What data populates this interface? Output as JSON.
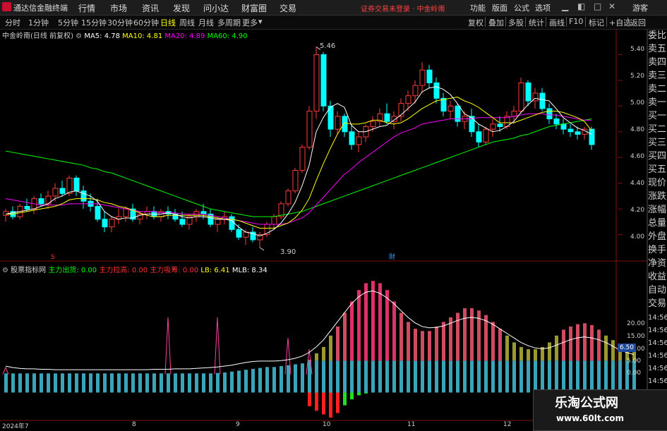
{
  "app": {
    "title": "通达信金融终端",
    "warning": "证券交易未登录 · 中金岭南"
  },
  "menus": [
    "行情",
    "市场",
    "资讯",
    "发现",
    "问小达",
    "财富圈",
    "交易"
  ],
  "right_menus": [
    "功能",
    "版面",
    "公式",
    "选项"
  ],
  "window_controls": {
    "guest": "游客"
  },
  "periods": [
    "分时",
    "1分钟",
    "5分钟",
    "15分钟",
    "30分钟",
    "60分钟",
    "日线",
    "周线",
    "月线",
    "多周期",
    "更多"
  ],
  "active_period": "日线",
  "tools": [
    "复权",
    "叠加",
    "多股",
    "统计",
    "画线",
    "F10",
    "标记",
    "+自选",
    "返回"
  ],
  "main_legend": {
    "stock": "中金岭南(日线 前复权)",
    "ma5": "MA5: 4.78",
    "ma10": "MA10: 4.81",
    "ma20": "MA20: 4.89",
    "ma60": "MA60: 4.90"
  },
  "indicator_legend": {
    "name": "股票指标网",
    "out": "主力出货: 0.00",
    "pull": "主力拉高: 0.00",
    "hold": "主力吸筹: 0.00",
    "lb": "LB: 6.41",
    "mlb": "MLB: 8.34"
  },
  "price_axis": [
    "5.40",
    "5.20",
    "5.00",
    "4.80",
    "4.60",
    "4.40",
    "4.20",
    "4.00"
  ],
  "indicator_axis": [
    "20.00",
    "15.00",
    "10.00",
    "5.00",
    "0.00"
  ],
  "indicator_tag": "6.50",
  "annotations": {
    "high": "5.46",
    "low": "3.90",
    "s_marker": "S",
    "cai_marker": "财"
  },
  "date_axis": [
    "2024年7",
    "8",
    "9",
    "10",
    "11",
    "12"
  ],
  "side_panel": [
    "委比",
    "卖五",
    "卖四",
    "卖三",
    "卖二",
    "卖一",
    "买一",
    "买二",
    "买三",
    "买四",
    "买五",
    "现价",
    "涨跌",
    "涨幅",
    "总量",
    "外盘",
    "换手",
    "净资",
    "收益",
    "自动",
    "交易"
  ],
  "side_times": [
    "14:56",
    "14:56",
    "14:56",
    "14:56",
    "14:56",
    "14:56",
    "14:56",
    "14:56"
  ],
  "watermark": {
    "line1": "乐淘公式网",
    "line2": "www.60lt.com"
  },
  "colors": {
    "up": "#ff3a3a",
    "down": "#00ffff",
    "ma5": "#ffffff",
    "ma10": "#ffff00",
    "ma20": "#ff00ff",
    "ma60": "#00ff00"
  },
  "chart_data": [
    {
      "type": "candlestick",
      "title": "中金岭南(日线 前复权)",
      "ylim": [
        3.85,
        5.55
      ],
      "annotations": {
        "high": 5.46,
        "low": 3.9
      },
      "candles": [
        [
          4.15,
          4.2,
          4.1,
          4.18
        ],
        [
          4.18,
          4.22,
          4.12,
          4.14
        ],
        [
          4.14,
          4.24,
          4.12,
          4.22
        ],
        [
          4.22,
          4.28,
          4.18,
          4.2
        ],
        [
          4.2,
          4.3,
          4.16,
          4.28
        ],
        [
          4.28,
          4.32,
          4.22,
          4.24
        ],
        [
          4.24,
          4.34,
          4.2,
          4.3
        ],
        [
          4.3,
          4.4,
          4.26,
          4.36
        ],
        [
          4.36,
          4.42,
          4.3,
          4.32
        ],
        [
          4.32,
          4.46,
          4.3,
          4.44
        ],
        [
          4.44,
          4.46,
          4.3,
          4.34
        ],
        [
          4.34,
          4.38,
          4.2,
          4.26
        ],
        [
          4.26,
          4.32,
          4.18,
          4.22
        ],
        [
          4.22,
          4.28,
          4.1,
          4.12
        ],
        [
          4.12,
          4.18,
          4.02,
          4.06
        ],
        [
          4.06,
          4.14,
          4.02,
          4.12
        ],
        [
          4.12,
          4.2,
          4.08,
          4.14
        ],
        [
          4.14,
          4.22,
          4.1,
          4.2
        ],
        [
          4.2,
          4.24,
          4.1,
          4.12
        ],
        [
          4.12,
          4.18,
          4.08,
          4.16
        ],
        [
          4.16,
          4.22,
          4.12,
          4.18
        ],
        [
          4.18,
          4.22,
          4.12,
          4.14
        ],
        [
          4.14,
          4.2,
          4.1,
          4.18
        ],
        [
          4.18,
          4.22,
          4.12,
          4.16
        ],
        [
          4.16,
          4.2,
          4.1,
          4.12
        ],
        [
          4.12,
          4.18,
          4.06,
          4.08
        ],
        [
          4.08,
          4.16,
          4.04,
          4.14
        ],
        [
          4.14,
          4.2,
          4.1,
          4.18
        ],
        [
          4.18,
          4.24,
          4.12,
          4.16
        ],
        [
          4.16,
          4.2,
          4.06,
          4.08
        ],
        [
          4.08,
          4.14,
          4.02,
          4.12
        ],
        [
          4.12,
          4.18,
          4.08,
          4.14
        ],
        [
          4.14,
          4.16,
          4.02,
          4.04
        ],
        [
          4.04,
          4.08,
          3.96,
          3.98
        ],
        [
          3.98,
          4.04,
          3.92,
          4.02
        ],
        [
          4.02,
          4.06,
          3.94,
          3.96
        ],
        [
          3.96,
          4.02,
          3.9,
          4.0
        ],
        [
          4.0,
          4.1,
          3.98,
          4.08
        ],
        [
          4.08,
          4.16,
          4.04,
          4.14
        ],
        [
          4.14,
          4.26,
          4.12,
          4.24
        ],
        [
          4.24,
          4.36,
          4.22,
          4.34
        ],
        [
          4.34,
          4.52,
          4.32,
          4.5
        ],
        [
          4.5,
          4.7,
          4.48,
          4.68
        ],
        [
          4.68,
          5.0,
          4.66,
          4.96
        ],
        [
          4.96,
          5.46,
          4.9,
          5.4
        ],
        [
          5.4,
          5.42,
          4.96,
          5.0
        ],
        [
          5.0,
          5.04,
          4.76,
          4.82
        ],
        [
          4.82,
          4.96,
          4.78,
          4.92
        ],
        [
          4.92,
          4.94,
          4.76,
          4.8
        ],
        [
          4.8,
          4.86,
          4.66,
          4.7
        ],
        [
          4.7,
          4.8,
          4.64,
          4.76
        ],
        [
          4.76,
          4.86,
          4.72,
          4.84
        ],
        [
          4.84,
          4.92,
          4.8,
          4.88
        ],
        [
          4.88,
          4.98,
          4.84,
          4.94
        ],
        [
          4.94,
          5.02,
          4.86,
          4.88
        ],
        [
          4.88,
          4.96,
          4.82,
          4.92
        ],
        [
          4.92,
          5.06,
          4.88,
          5.02
        ],
        [
          5.02,
          5.12,
          4.96,
          5.08
        ],
        [
          5.08,
          5.2,
          5.02,
          5.16
        ],
        [
          5.16,
          5.34,
          5.1,
          5.28
        ],
        [
          5.28,
          5.32,
          5.14,
          5.18
        ],
        [
          5.18,
          5.22,
          5.02,
          5.06
        ],
        [
          5.06,
          5.1,
          4.92,
          4.96
        ],
        [
          4.96,
          5.04,
          4.9,
          5.0
        ],
        [
          5.0,
          5.02,
          4.84,
          4.88
        ],
        [
          4.88,
          4.96,
          4.82,
          4.92
        ],
        [
          4.92,
          4.98,
          4.76,
          4.8
        ],
        [
          4.8,
          4.86,
          4.68,
          4.72
        ],
        [
          4.72,
          4.84,
          4.7,
          4.82
        ],
        [
          4.82,
          4.9,
          4.76,
          4.86
        ],
        [
          4.86,
          4.92,
          4.8,
          4.84
        ],
        [
          4.84,
          4.96,
          4.82,
          4.92
        ],
        [
          4.92,
          5.0,
          4.86,
          4.96
        ],
        [
          4.96,
          5.22,
          4.94,
          5.18
        ],
        [
          5.18,
          5.2,
          5.0,
          5.04
        ],
        [
          5.04,
          5.14,
          4.98,
          5.1
        ],
        [
          5.1,
          5.14,
          4.96,
          4.98
        ],
        [
          4.98,
          5.02,
          4.86,
          4.9
        ],
        [
          4.9,
          4.94,
          4.82,
          4.86
        ],
        [
          4.86,
          4.9,
          4.78,
          4.82
        ],
        [
          4.82,
          4.86,
          4.76,
          4.8
        ],
        [
          4.8,
          4.84,
          4.74,
          4.78
        ],
        [
          4.78,
          4.84,
          4.74,
          4.82
        ],
        [
          4.82,
          4.84,
          4.66,
          4.7
        ]
      ],
      "ma5": [
        4.16,
        4.17,
        4.18,
        4.19,
        4.2,
        4.22,
        4.24,
        4.28,
        4.3,
        4.33,
        4.34,
        4.32,
        4.3,
        4.26,
        4.18,
        4.14,
        4.12,
        4.13,
        4.13,
        4.15,
        4.16,
        4.16,
        4.16,
        4.17,
        4.16,
        4.14,
        4.13,
        4.14,
        4.14,
        4.13,
        4.12,
        4.12,
        4.11,
        4.06,
        4.02,
        4.01,
        3.99,
        4.01,
        4.04,
        4.09,
        4.16,
        4.25,
        4.38,
        4.54,
        4.8,
        4.91,
        4.99,
        5.02,
        4.99,
        4.85,
        4.8,
        4.8,
        4.82,
        4.84,
        4.85,
        4.89,
        4.93,
        4.98,
        5.03,
        5.11,
        5.14,
        5.15,
        5.13,
        5.09,
        5.02,
        4.94,
        4.91,
        4.86,
        4.83,
        4.8,
        4.81,
        4.84,
        4.88,
        4.95,
        5.01,
        5.06,
        5.05,
        5.04,
        4.98,
        4.91,
        4.87,
        4.83,
        4.81,
        4.78
      ],
      "ma10": [
        4.16,
        4.16,
        4.17,
        4.18,
        4.19,
        4.2,
        4.21,
        4.22,
        4.24,
        4.27,
        4.28,
        4.28,
        4.28,
        4.27,
        4.25,
        4.24,
        4.22,
        4.21,
        4.19,
        4.17,
        4.15,
        4.14,
        4.14,
        4.15,
        4.15,
        4.15,
        4.15,
        4.15,
        4.15,
        4.14,
        4.13,
        4.12,
        4.12,
        4.11,
        4.09,
        4.07,
        4.05,
        4.05,
        4.05,
        4.07,
        4.09,
        4.13,
        4.19,
        4.28,
        4.42,
        4.55,
        4.67,
        4.78,
        4.87,
        4.86,
        4.86,
        4.87,
        4.89,
        4.89,
        4.87,
        4.86,
        4.87,
        4.9,
        4.94,
        4.98,
        5.01,
        5.04,
        5.05,
        5.06,
        5.07,
        5.04,
        5.02,
        4.99,
        4.95,
        4.91,
        4.87,
        4.87,
        4.87,
        4.89,
        4.91,
        4.93,
        4.95,
        4.96,
        4.96,
        4.95,
        4.93,
        4.91,
        4.88,
        4.81
      ],
      "ma20": [
        4.28,
        4.27,
        4.26,
        4.25,
        4.24,
        4.23,
        4.23,
        4.23,
        4.23,
        4.24,
        4.24,
        4.24,
        4.24,
        4.24,
        4.23,
        4.22,
        4.21,
        4.2,
        4.19,
        4.18,
        4.18,
        4.18,
        4.17,
        4.17,
        4.17,
        4.16,
        4.16,
        4.16,
        4.16,
        4.15,
        4.14,
        4.13,
        4.12,
        4.11,
        4.1,
        4.09,
        4.08,
        4.08,
        4.08,
        4.08,
        4.09,
        4.11,
        4.13,
        4.17,
        4.23,
        4.29,
        4.35,
        4.41,
        4.47,
        4.51,
        4.56,
        4.6,
        4.64,
        4.68,
        4.72,
        4.76,
        4.79,
        4.81,
        4.83,
        4.86,
        4.87,
        4.88,
        4.89,
        4.9,
        4.9,
        4.9,
        4.9,
        4.91,
        4.91,
        4.91,
        4.91,
        4.91,
        4.92,
        4.93,
        4.94,
        4.94,
        4.94,
        4.93,
        4.93,
        4.92,
        4.91,
        4.9,
        4.89,
        4.89
      ],
      "ma60": [
        4.65,
        4.64,
        4.63,
        4.62,
        4.61,
        4.6,
        4.59,
        4.58,
        4.57,
        4.56,
        4.55,
        4.54,
        4.52,
        4.51,
        4.49,
        4.48,
        4.46,
        4.44,
        4.42,
        4.4,
        4.38,
        4.36,
        4.34,
        4.32,
        4.3,
        4.28,
        4.26,
        4.24,
        4.22,
        4.2,
        4.19,
        4.18,
        4.17,
        4.16,
        4.15,
        4.14,
        4.14,
        4.14,
        4.14,
        4.15,
        4.16,
        4.17,
        4.18,
        4.2,
        4.22,
        4.24,
        4.26,
        4.28,
        4.3,
        4.32,
        4.34,
        4.36,
        4.38,
        4.4,
        4.42,
        4.44,
        4.46,
        4.48,
        4.5,
        4.52,
        4.54,
        4.56,
        4.58,
        4.6,
        4.62,
        4.64,
        4.66,
        4.68,
        4.7,
        4.72,
        4.73,
        4.74,
        4.75,
        4.77,
        4.78,
        4.8,
        4.82,
        4.84,
        4.85,
        4.86,
        4.87,
        4.88,
        4.89,
        4.9
      ]
    },
    {
      "type": "bar",
      "title": "股票指标网",
      "ylim": [
        -5.5,
        25
      ],
      "lb_bars": [
        4.2,
        4.2,
        4.2,
        4.2,
        4.2,
        4.2,
        4.2,
        4.2,
        4.2,
        4.2,
        4.2,
        4.2,
        4.2,
        4.2,
        4.2,
        4.2,
        4.2,
        4.2,
        4.2,
        4.2,
        4.2,
        4.2,
        4.2,
        4.2,
        4.2,
        4.2,
        4.2,
        4.2,
        4.2,
        4.2,
        4.3,
        4.4,
        4.6,
        4.8,
        5.0,
        5.2,
        5.4,
        5.6,
        5.6,
        5.8,
        6.0,
        6.2,
        6.4,
        7.2,
        8.6,
        10.0,
        12.5,
        14.5,
        17.5,
        20.0,
        22.5,
        24.0,
        24.5,
        24.0,
        22.5,
        20.0,
        17.5,
        15.5,
        14.0,
        13.5,
        13.5,
        14.5,
        15.5,
        16.5,
        17.5,
        18.5,
        18.5,
        18.0,
        17.0,
        15.5,
        14.0,
        12.5,
        11.0,
        10.0,
        9.5,
        9.5,
        10.0,
        11.0,
        12.5,
        13.8,
        14.5,
        15.0,
        15.2,
        14.8,
        13.8,
        12.5,
        11.5,
        10.5,
        10.0,
        9.8
      ],
      "mlb_line": [
        5.8,
        5.5,
        5.3,
        5.2,
        5.2,
        5.1,
        5.1,
        5.0,
        5.0,
        5.0,
        5.0,
        5.0,
        5.0,
        5.0,
        5.0,
        5.0,
        5.0,
        5.0,
        5.0,
        5.0,
        5.0,
        5.1,
        5.1,
        5.1,
        5.2,
        5.2,
        5.2,
        5.3,
        5.4,
        5.5,
        5.6,
        5.8,
        6.0,
        6.3,
        6.6,
        6.8,
        6.9,
        6.9,
        6.9,
        7.0,
        7.2,
        7.5,
        8.0,
        8.8,
        10.0,
        11.5,
        13.5,
        15.5,
        17.5,
        19.5,
        21.0,
        22.0,
        22.3,
        21.8,
        20.8,
        19.5,
        18.0,
        16.5,
        15.3,
        14.5,
        14.2,
        14.3,
        14.6,
        15.2,
        15.8,
        16.3,
        16.5,
        16.3,
        15.8,
        15.0,
        14.0,
        13.0,
        12.0,
        11.0,
        10.3,
        9.8,
        9.6,
        9.8,
        10.4,
        11.0,
        11.6,
        12.0,
        12.2,
        12.0,
        11.6,
        11.0,
        10.2,
        9.3,
        8.8,
        8.34
      ],
      "neg_bars": [
        0,
        0,
        0,
        0,
        0,
        0,
        0,
        0,
        0,
        0,
        0,
        0,
        0,
        0,
        0,
        0,
        0,
        0,
        0,
        0,
        0,
        0,
        0,
        0,
        0,
        0,
        0,
        0,
        0,
        0,
        0,
        0,
        0,
        0,
        0,
        0,
        0,
        0,
        0,
        0,
        0,
        0,
        0,
        -3.0,
        -4.0,
        -4.8,
        -5.5,
        -4.5,
        -2.8,
        -1.5,
        -0.6,
        -0.2,
        0,
        0,
        0,
        0,
        0,
        0,
        0,
        0,
        0,
        0,
        0,
        0,
        0,
        0,
        0,
        0,
        0,
        0,
        0,
        0,
        0,
        0,
        0,
        0,
        0,
        0,
        0,
        0,
        0,
        0,
        0,
        0,
        0,
        0,
        0,
        0,
        0,
        0
      ],
      "spikes": [
        [
          0,
          5.5
        ],
        [
          23,
          16.5
        ],
        [
          30,
          16.5
        ],
        [
          40,
          12.0
        ],
        [
          43,
          9.5
        ]
      ]
    }
  ]
}
